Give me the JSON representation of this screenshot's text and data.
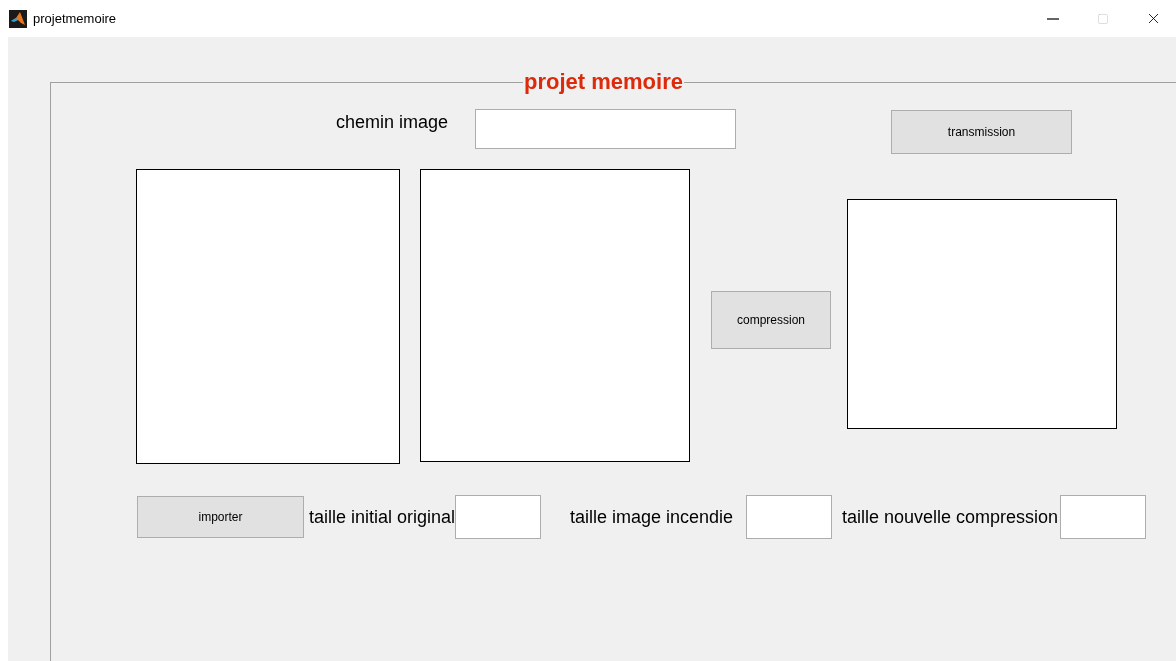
{
  "window": {
    "title": "projetmemoire"
  },
  "panel": {
    "title": "projet memoire"
  },
  "path_field": {
    "label": "chemin image"
  },
  "buttons": {
    "transmission": "transmission",
    "compression": "compression",
    "import": "importer"
  },
  "size_fields": [
    {
      "label": "taille initial original"
    },
    {
      "label": "taille image incendie"
    },
    {
      "label": "taille nouvelle compression"
    }
  ]
}
